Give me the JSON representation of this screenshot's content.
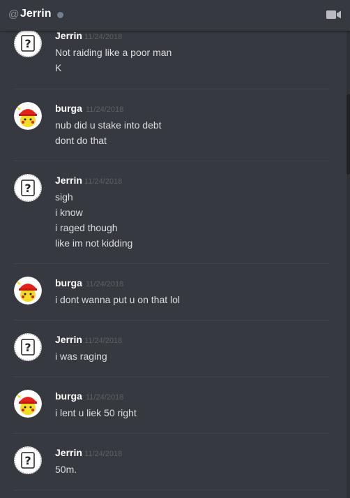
{
  "header": {
    "at_symbol": "@",
    "title": "Jerrin",
    "status": "offline",
    "video_icon": "video-camera-icon"
  },
  "colors": {
    "background": "#36393f",
    "username": "#ffffff",
    "message_text": "#dcddde",
    "timestamp": "#5d6064",
    "status_offline": "#747f8d"
  },
  "messages": [
    {
      "author": "Jerrin",
      "avatar": "default-question-avatar",
      "timestamp": "11/24/2018",
      "lines": [
        "Not raiding like a poor man",
        "K"
      ]
    },
    {
      "author": "burga",
      "avatar": "pikachu-red-cap-avatar",
      "timestamp": "11/24/2018",
      "lines": [
        "nub did u stake into debt",
        "dont do that"
      ]
    },
    {
      "author": "Jerrin",
      "avatar": "default-question-avatar",
      "timestamp": "11/24/2018",
      "lines": [
        "sigh",
        "i know",
        "i raged though",
        "like im not kidding"
      ]
    },
    {
      "author": "burga",
      "avatar": "pikachu-red-cap-avatar",
      "timestamp": "11/24/2018",
      "lines": [
        "i dont wanna put u on that lol"
      ]
    },
    {
      "author": "Jerrin",
      "avatar": "default-question-avatar",
      "timestamp": "11/24/2018",
      "lines": [
        "i was raging"
      ]
    },
    {
      "author": "burga",
      "avatar": "pikachu-red-cap-avatar",
      "timestamp": "11/24/2018",
      "lines": [
        "i lent u liek 50 right"
      ]
    },
    {
      "author": "Jerrin",
      "avatar": "default-question-avatar",
      "timestamp": "11/24/2018",
      "lines": [
        "50m."
      ]
    }
  ]
}
